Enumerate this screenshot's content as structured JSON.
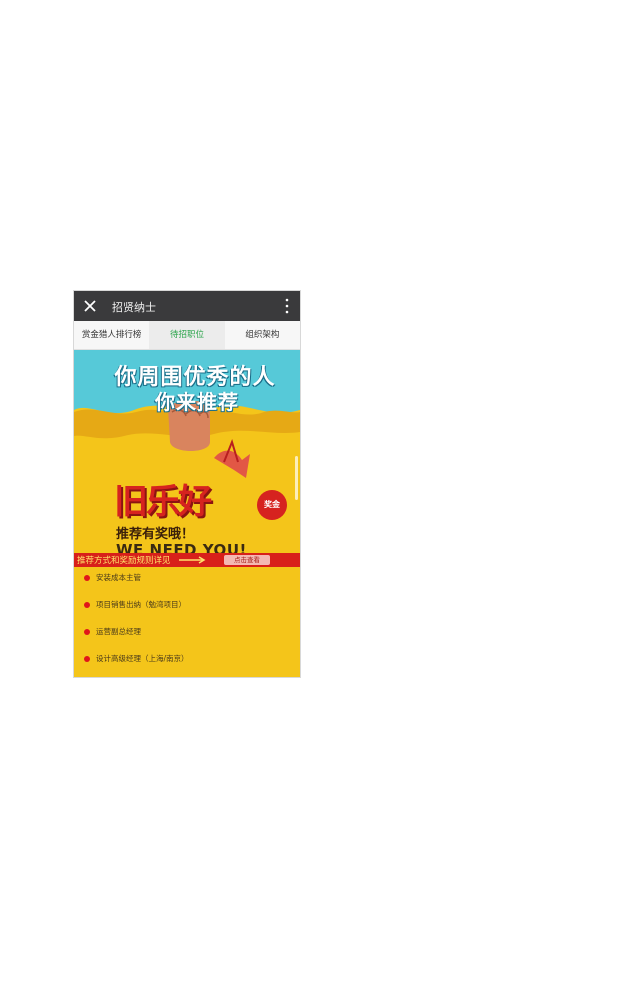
{
  "titlebar": {
    "title": "招贤纳士"
  },
  "tabs": [
    {
      "label": "赏金猎人排行榜"
    },
    {
      "label": "待招职位"
    },
    {
      "label": "组织架构"
    }
  ],
  "hero": {
    "line1": "你周围优秀的人",
    "line2": "你来推荐",
    "big_title": "旧乐好",
    "stamp": "奖金",
    "slogan": "推荐有奖哦！",
    "need": "WE NEED YOU!"
  },
  "banner": {
    "text": "推荐方式和奖励规则详见",
    "button": "点击查看"
  },
  "jobs": [
    {
      "label": "安装成本主管"
    },
    {
      "label": "项目销售出纳（勉湾项目）"
    },
    {
      "label": "运营副总经理"
    },
    {
      "label": "设计高级经理（上海/南京）"
    }
  ],
  "colors": {
    "accent": "#2aa44a",
    "brand_red": "#d8201a",
    "background_yellow": "#f4c51a",
    "sky": "#4fc6d6"
  }
}
